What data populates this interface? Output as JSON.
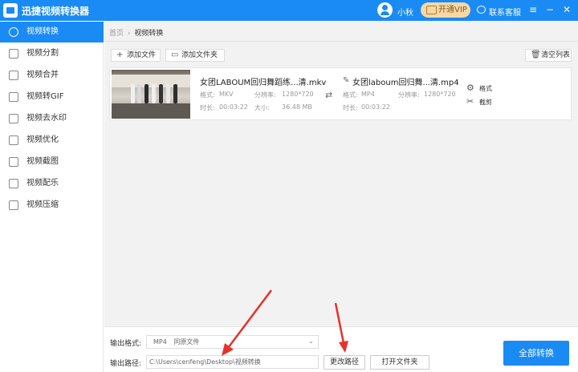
{
  "app": {
    "title": "迅捷视频转换器"
  },
  "header": {
    "user_name": "小秋",
    "vip_label": "开通VIP",
    "support_label": "联系客服",
    "controls": [
      "menu",
      "minimize",
      "close"
    ]
  },
  "sidebar": {
    "items": [
      {
        "label": "视频转换",
        "icon": "convert-icon",
        "active": true
      },
      {
        "label": "视频分割",
        "icon": "split-icon"
      },
      {
        "label": "视频合并",
        "icon": "merge-icon"
      },
      {
        "label": "视频转GIF",
        "icon": "gif-icon"
      },
      {
        "label": "视频去水印",
        "icon": "watermark-icon"
      },
      {
        "label": "视频优化",
        "icon": "optimize-icon"
      },
      {
        "label": "视频截图",
        "icon": "screenshot-icon"
      },
      {
        "label": "视频配乐",
        "icon": "music-icon"
      },
      {
        "label": "视频压缩",
        "icon": "compress-icon"
      }
    ]
  },
  "breadcrumb": {
    "home": "首页",
    "separator": "›",
    "current": "视频转换"
  },
  "toolbar": {
    "add_file": "添加文件",
    "add_folder": "添加文件夹",
    "clear_list": "清空列表"
  },
  "file": {
    "source": {
      "name": "女团LABOUM回归舞蹈练...清.mkv",
      "format_label": "格式:",
      "format": "MKV",
      "resolution_label": "分辨率:",
      "resolution": "1280*720",
      "duration_label": "时长:",
      "duration": "00:03:22",
      "size_label": "大小:",
      "size": "36.48 MB"
    },
    "output": {
      "name": "女团laboum回归舞...清.mp4",
      "format_label": "格式:",
      "format": "MP4",
      "resolution_label": "分辨率:",
      "resolution": "1280*720",
      "duration_label": "时长:",
      "duration": "00:03:22"
    },
    "actions": {
      "format": "格式",
      "cut": "截剪"
    }
  },
  "bottom": {
    "output_format_label": "输出格式:",
    "output_format_value": "MP4",
    "output_format_desc": "同原文件",
    "output_path_label": "输出路径:",
    "output_path_value": "C:\\Users\\cenfeng\\Desktop\\视频转换",
    "change_path": "更改路径",
    "open_folder": "打开文件夹",
    "convert_all": "全部转换"
  },
  "colors": {
    "accent": "#1a8af5",
    "vip": "#f5d8a6",
    "annotation": "#e8312b"
  }
}
